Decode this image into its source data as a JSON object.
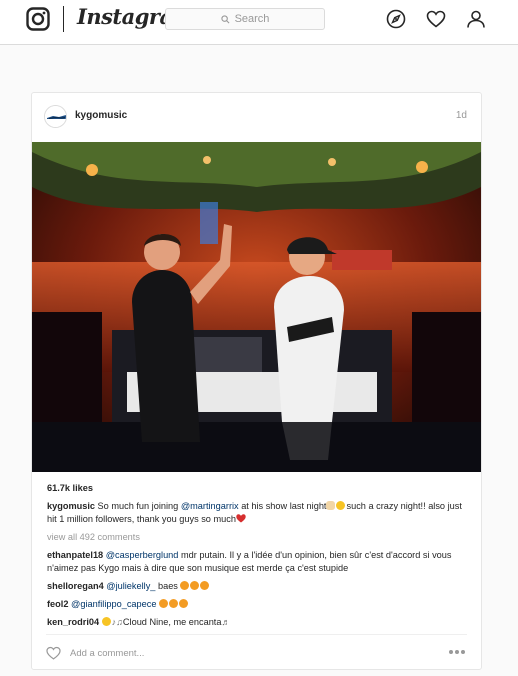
{
  "nav": {
    "brand": "Instagram",
    "logo_icon": "camera-logo-icon",
    "search_placeholder": "Search",
    "icons": [
      "compass-icon",
      "heart-icon",
      "profile-icon"
    ]
  },
  "post": {
    "username": "kygomusic",
    "age": "1d",
    "likes": "61.7k likes",
    "caption": {
      "username": "kygomusic",
      "text_1": " So much fun joining ",
      "mention": "@martingarrix",
      "text_2": " at his show last night",
      "text_3": "such a crazy night!! also just hit 1 million followers, thank you guys so much"
    },
    "view_all": "view all 492 comments",
    "comments": [
      {
        "username": "ethanpatel18",
        "mention": "@casperberglund",
        "text": " mdr putain. Il y a l'idée d'un opinion, bien sûr c'est d'accord si vous n'aimez pas Kygo mais à dire que son musique est merde ça c'est stupide"
      },
      {
        "username": "shelloregan4",
        "mention": "@juliekelly_",
        "text": " baes"
      },
      {
        "username": "feol2",
        "mention": "@gianfilippo_capece",
        "text": ""
      },
      {
        "username": "ken_rodri04",
        "mention": "",
        "text": "Cloud Nine, me encanta"
      }
    ],
    "add_comment_placeholder": "Add a comment...",
    "colors": {
      "heart_emoji": "#d62e2e",
      "accent_link": "#003569",
      "muted": "#999999"
    }
  }
}
